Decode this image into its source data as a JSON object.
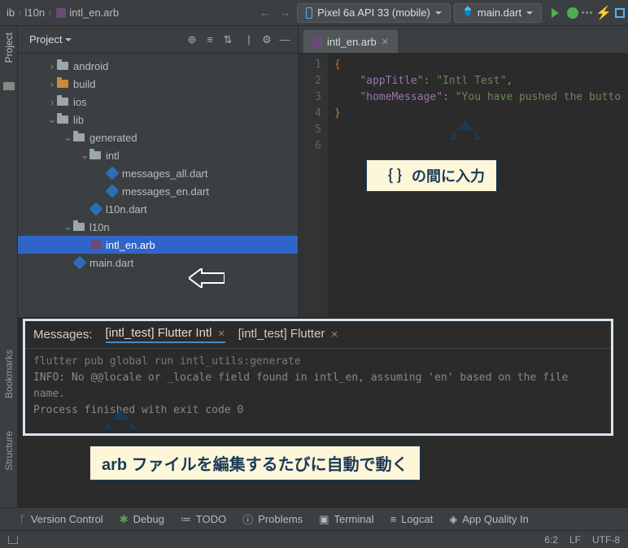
{
  "breadcrumbs": {
    "root": "ib",
    "mid": "l10n",
    "file": "intl_en.arb"
  },
  "device": {
    "label": "Pixel 6a API 33 (mobile)"
  },
  "run_config": {
    "label": "main.dart"
  },
  "project_panel": {
    "title": "Project"
  },
  "tree": {
    "android": "android",
    "build": "build",
    "ios": "ios",
    "lib": "lib",
    "generated": "generated",
    "intl": "intl",
    "messages_all": "messages_all.dart",
    "messages_en": "messages_en.dart",
    "l10n_dart": "l10n.dart",
    "l10n": "l10n",
    "intl_en_arb": "intl_en.arb",
    "main_dart": "main.dart"
  },
  "editor": {
    "tab": "intl_en.arb",
    "lines": {
      "l1": "{",
      "k1": "\"appTitle\"",
      "v1": "\"Intl Test\"",
      "k2": "\"homeMessage\"",
      "v2": "\"You have pushed the butto",
      "l4": "}"
    }
  },
  "annot1": "｛ ｝の間に入力",
  "messages": {
    "label": "Messages:",
    "tab1": "[intl_test] Flutter Intl",
    "tab2": "[intl_test] Flutter",
    "cmd": "flutter pub global run intl_utils:generate",
    "info": "INFO: No @@locale or _locale field found in intl_en, assuming 'en' based on the file name.",
    "done": "Process finished with exit code 0"
  },
  "annot2": "arb ファイルを編集するたびに自動で動く",
  "gutter": {
    "project": "Project",
    "bookmarks": "Bookmarks",
    "structure": "Structure"
  },
  "bottom_tools": {
    "vcs": "Version Control",
    "debug": "Debug",
    "todo": "TODO",
    "problems": "Problems",
    "terminal": "Terminal",
    "logcat": "Logcat",
    "appq": "App Quality In"
  },
  "status": {
    "pos": "6:2",
    "lf": "LF",
    "enc": "UTF-8"
  }
}
